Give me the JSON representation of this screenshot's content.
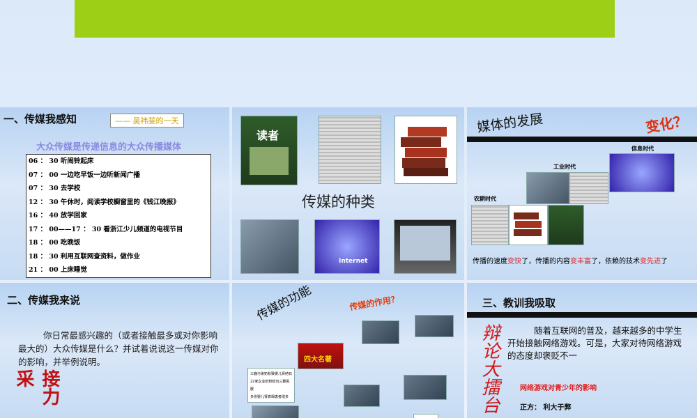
{
  "panel1": {
    "title": "一、传媒我感知",
    "subtitle": "——  吴祎斐的一天",
    "headline": "大众传媒是传递信息的大众传播媒体",
    "schedule": [
      "06 ： 30 听闹铃起床",
      "07 ： 00 一边吃早饭一边听新闻广播",
      "07 ： 30 去学校",
      "12 ： 30 午休时，阅读学校橱窗里的《钱江晚报》",
      "16 ： 40 放学回家",
      "17 ： 00——17 ： 30 看浙江少儿频道的电视节目",
      "18 ： 00 吃晚饭",
      "18 ： 30 利用互联网查资料，做作业",
      "21 ： 00 上床睡觉"
    ]
  },
  "panel2": {
    "title": "传媒的种类",
    "magazine_logo": "读者",
    "internet_label": "Internet"
  },
  "panel3": {
    "title": "媒体的发展",
    "exclaim": "变化？",
    "era_agri": "农耕时代",
    "era_ind": "工业时代",
    "era_info": "信息时代",
    "cap1": "传播的速度",
    "cap2": "变快",
    "cap3": "了，传播的内容",
    "cap4": "变丰富",
    "cap5": "了，依赖的技术",
    "cap6": "变先进",
    "cap7": "了"
  },
  "panel4": {
    "title": "二、传媒我来说",
    "body": "你日常最感兴趣的（或者接触最多或对你影响最大的）大众传媒是什么？并试着说说这一传媒对你的影响，并举例说明。",
    "vertical": "接力采"
  },
  "panel5": {
    "title": "传媒的功能",
    "red_tilt": "传媒的作用？",
    "card_text": "四大名著",
    "news_line1": "三鹿污染奶粉致婴儿肾结石",
    "news_line2": "22家企业奶粉检出三聚氰胺",
    "news_line3": "多省婴儿肾衰竭患者增多"
  },
  "panel6": {
    "title": "三、教训我吸取",
    "vertical": "辩论大擂台",
    "body": "随着互联网的普及，越来越多的中学生开始接触网络游戏。可是，大家对待网络游戏的态度却褒贬不一",
    "topic": "网络游戏对青少年的影响",
    "side": "正方： 利大于弊"
  }
}
